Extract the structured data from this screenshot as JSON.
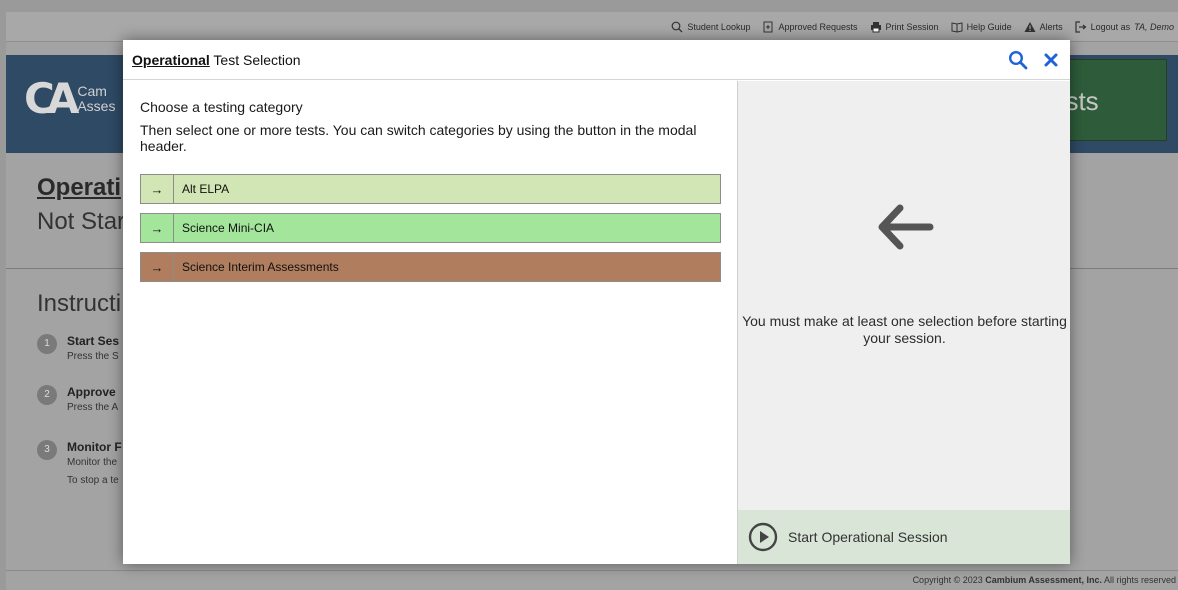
{
  "topbar": {
    "student_lookup": "Student Lookup",
    "approved_requests": "Approved Requests",
    "print_session": "Print Session",
    "help_guide": "Help Guide",
    "alerts": "Alerts",
    "logout_prefix": "Logout as",
    "logout_user": "TA, Demo"
  },
  "banner": {
    "logo_mark": "CA",
    "logo_line1": "Cam",
    "logo_line2": "Asses",
    "right_label": "ests"
  },
  "session": {
    "title": "Operati",
    "status": "Not Star"
  },
  "instructions": {
    "title": "Instructi",
    "steps": [
      {
        "num": "1",
        "title": "Start Ses",
        "desc": "Press the S",
        "desc2": ""
      },
      {
        "num": "2",
        "title": "Approve",
        "desc": "Press the A",
        "desc2": ""
      },
      {
        "num": "3",
        "title": "Monitor F",
        "desc": "Monitor the",
        "desc2": "To stop a te"
      }
    ]
  },
  "footer": {
    "text_prefix": "Copyright © 2023 ",
    "company": "Cambium Assessment, Inc.",
    "text_suffix": " All rights reserved"
  },
  "modal": {
    "title_emph": "Operational",
    "title_rest": " Test Selection",
    "instruction_1": "Choose a testing category",
    "instruction_2": "Then select one or more tests. You can switch categories by using the button in the modal header.",
    "categories": [
      {
        "label": "Alt ELPA",
        "color": "#d2e5b4"
      },
      {
        "label": "Science Mini-CIA",
        "color": "#a3e59b"
      },
      {
        "label": "Science Interim Assessments",
        "color": "#b07e5e"
      }
    ],
    "arrow_glyph": "→",
    "right_message": "You must make at least one selection before starting your session.",
    "start_button": "Start Operational Session"
  },
  "colors": {
    "accent_blue": "#1f63d6",
    "start_bg": "#d9e6d7"
  }
}
